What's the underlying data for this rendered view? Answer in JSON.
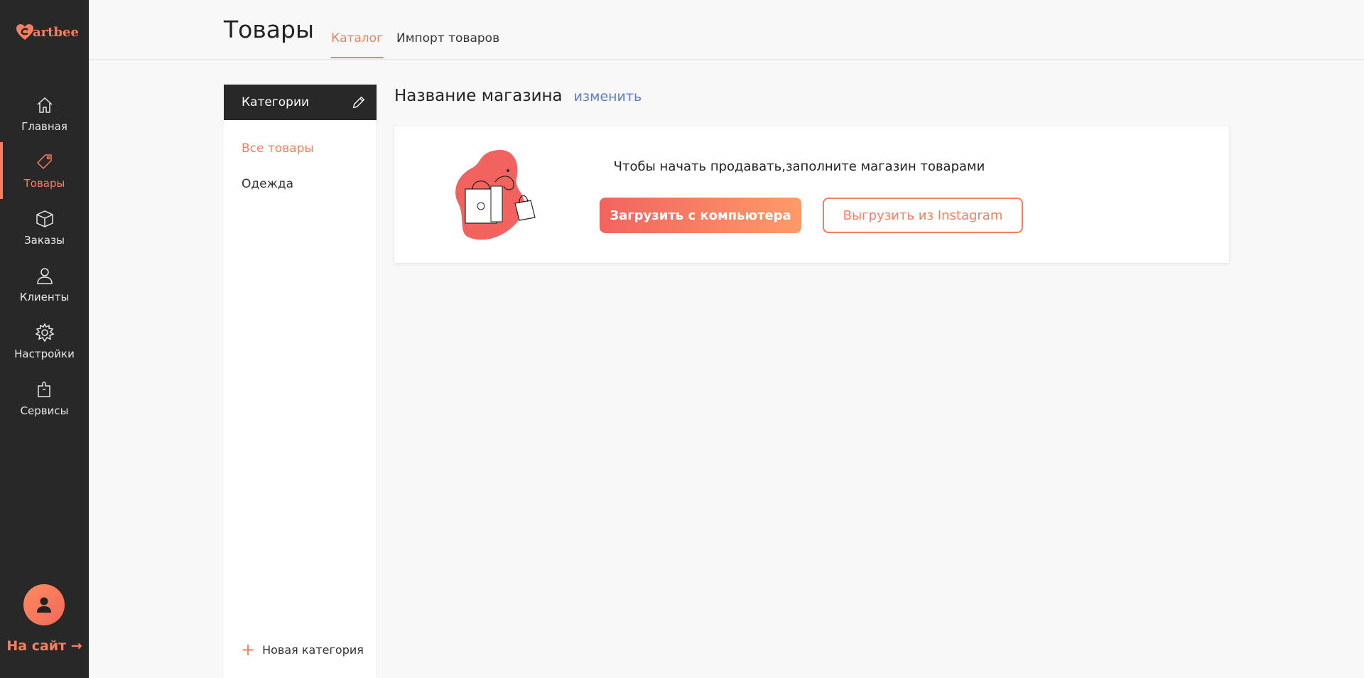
{
  "app": {
    "brand": "artbee"
  },
  "sidebar": {
    "items": [
      {
        "label": "Главная",
        "icon": "home-icon"
      },
      {
        "label": "Товары",
        "icon": "tag-icon",
        "active": true
      },
      {
        "label": "Заказы",
        "icon": "box-icon"
      },
      {
        "label": "Клиенты",
        "icon": "user-icon"
      },
      {
        "label": "Настройки",
        "icon": "gear-icon"
      },
      {
        "label": "Сервисы",
        "icon": "puzzle-icon"
      }
    ],
    "to_site": "На сайт →"
  },
  "header": {
    "title": "Товары",
    "tabs": [
      {
        "label": "Каталог",
        "active": true
      },
      {
        "label": "Импорт товаров",
        "active": false
      }
    ]
  },
  "categories": {
    "title": "Категории",
    "items": [
      {
        "label": "Все товары",
        "active": true
      },
      {
        "label": "Одежда",
        "active": false
      }
    ],
    "new_label": "Новая категория"
  },
  "main": {
    "store_name": "Название магазина",
    "edit_link": "изменить",
    "empty_message": "Чтобы начать продавать,заполните магазин товарами",
    "upload_button": "Загрузить с компьютера",
    "instagram_button": "Выгрузить из Instagram"
  },
  "colors": {
    "accent": "#f77e5e",
    "sidebar_bg": "#282828",
    "link": "#5b7ec7"
  }
}
